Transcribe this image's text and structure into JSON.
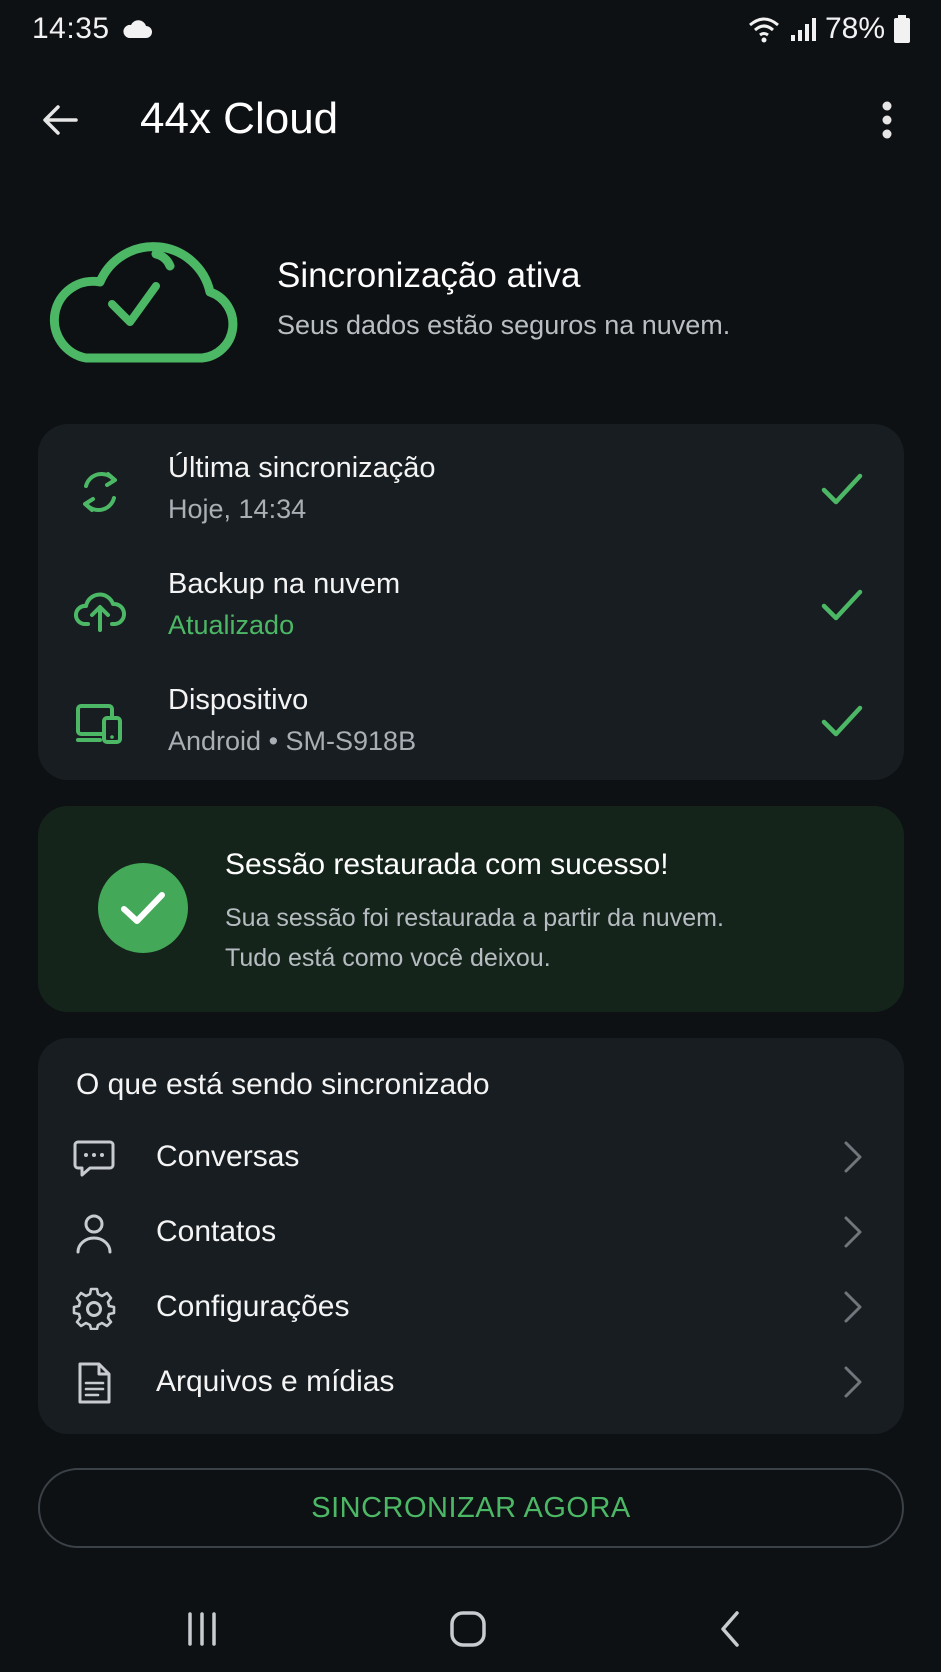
{
  "status_bar": {
    "time": "14:35",
    "battery_percent": "78%",
    "icons": [
      "cloud-icon",
      "wifi-icon",
      "signal-icon",
      "battery-icon"
    ]
  },
  "app_bar": {
    "title": "44x Cloud",
    "back_icon": "arrow-back-icon",
    "menu_icon": "more-vert-icon"
  },
  "hero": {
    "title": "Sincronização ativa",
    "subtitle": "Seus dados estão seguros na nuvem.",
    "icon": "cloud-check-icon"
  },
  "status_items": [
    {
      "icon": "sync-icon",
      "title": "Última sincronização",
      "subtitle": "Hoje, 14:34",
      "subtitle_highlight": false
    },
    {
      "icon": "cloud-upload-icon",
      "title": "Backup na nuvem",
      "subtitle": "Atualizado",
      "subtitle_highlight": true
    },
    {
      "icon": "device-icon",
      "title": "Dispositivo",
      "subtitle": "Android • SM-S918B",
      "subtitle_highlight": false
    }
  ],
  "success": {
    "title": "Sessão restaurada com sucesso!",
    "line1": "Sua sessão foi restaurada a partir da nuvem.",
    "line2": "Tudo está como você deixou."
  },
  "sync_section": {
    "heading": "O que está sendo sincronizado",
    "items": [
      {
        "icon": "chat-icon",
        "label": "Conversas"
      },
      {
        "icon": "person-icon",
        "label": "Contatos"
      },
      {
        "icon": "gear-icon",
        "label": "Configurações"
      },
      {
        "icon": "document-icon",
        "label": "Arquivos e mídias"
      }
    ]
  },
  "sync_button": {
    "label": "SINCRONIZAR AGORA"
  },
  "colors": {
    "background": "#0d1114",
    "card": "#171d21",
    "success_card": "#15241b",
    "accent_green": "#4cb865",
    "text_secondary": "#a9afb5"
  }
}
